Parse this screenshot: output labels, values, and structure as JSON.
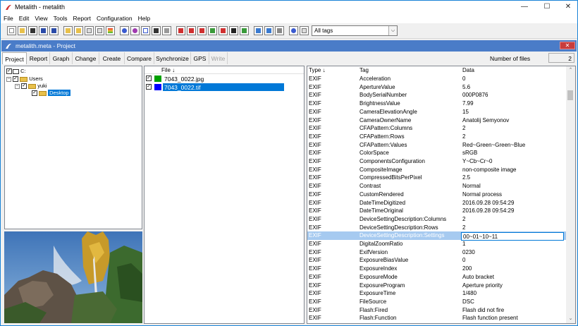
{
  "window": {
    "title": "Metalith - metalith",
    "controls": [
      "—",
      "☐",
      "✕"
    ]
  },
  "menu": [
    "File",
    "Edit",
    "View",
    "Tools",
    "Report",
    "Configuration",
    "Help"
  ],
  "toolbar": {
    "tag_filter": "All tags"
  },
  "project": {
    "title": "metalith.meta - Project",
    "close_symbol": "✕"
  },
  "tabs": [
    "Project",
    "Report",
    "Graph",
    "Change",
    "Create",
    "Compare",
    "Synchronize",
    "GPS",
    "Write"
  ],
  "number_of_files": {
    "label": "Number of files",
    "value": "2"
  },
  "tree": {
    "root": "C:",
    "users": "Users",
    "yuki": "yuki",
    "desktop": "Desktop"
  },
  "files": {
    "header": "File ↓",
    "rows": [
      {
        "name": "7043_0022.jpg",
        "color": "#00a000"
      },
      {
        "name": "7043_0022.tif",
        "color": "#0000ff"
      }
    ]
  },
  "grid": {
    "headers": {
      "type": "Type ↓",
      "tag": "Tag",
      "data": "Data"
    },
    "rows": [
      [
        "EXIF",
        "Acceleration",
        "0"
      ],
      [
        "EXIF",
        "ApertureValue",
        "5.6"
      ],
      [
        "EXIF",
        "BodySerialNumber",
        "000P0876"
      ],
      [
        "EXIF",
        "BrightnessValue",
        "7.99"
      ],
      [
        "EXIF",
        "CameraElevationAngle",
        "15"
      ],
      [
        "EXIF",
        "CameraOwnerName",
        "Anatolij Semyonov"
      ],
      [
        "EXIF",
        "CFAPattern:Columns",
        "2"
      ],
      [
        "EXIF",
        "CFAPattern:Rows",
        "2"
      ],
      [
        "EXIF",
        "CFAPattern:Values",
        "Red~Green~Green~Blue"
      ],
      [
        "EXIF",
        "ColorSpace",
        "sRGB"
      ],
      [
        "EXIF",
        "ComponentsConfiguration",
        "Y~Cb~Cr~0"
      ],
      [
        "EXIF",
        "CompositeImage",
        "non-composite image"
      ],
      [
        "EXIF",
        "CompressedBitsPerPixel",
        "2.5"
      ],
      [
        "EXIF",
        "Contrast",
        "Normal"
      ],
      [
        "EXIF",
        "CustomRendered",
        "Normal process"
      ],
      [
        "EXIF",
        "DateTimeDigitized",
        "2016.09.28 09:54:29"
      ],
      [
        "EXIF",
        "DateTimeOriginal",
        "2016.09.28 09:54:29"
      ],
      [
        "EXIF",
        "DeviceSettingDescription:Columns",
        "2"
      ],
      [
        "EXIF",
        "DeviceSettingDescription:Rows",
        "2"
      ],
      [
        "EXIF",
        "DeviceSettingDescription:Settings",
        "00~01~10~11"
      ],
      [
        "EXIF",
        "DigitalZoomRatio",
        "1"
      ],
      [
        "EXIF",
        "ExifVersion",
        "0230"
      ],
      [
        "EXIF",
        "ExposureBiasValue",
        "0"
      ],
      [
        "EXIF",
        "ExposureIndex",
        "200"
      ],
      [
        "EXIF",
        "ExposureMode",
        "Auto bracket"
      ],
      [
        "EXIF",
        "ExposureProgram",
        "Aperture priority"
      ],
      [
        "EXIF",
        "ExposureTime",
        "1/480"
      ],
      [
        "EXIF",
        "FileSource",
        "DSC"
      ],
      [
        "EXIF",
        "Flash:Fired",
        "Flash did not fire"
      ],
      [
        "EXIF",
        "Flash:Function",
        "Flash function present"
      ]
    ],
    "selected_row": 19
  }
}
